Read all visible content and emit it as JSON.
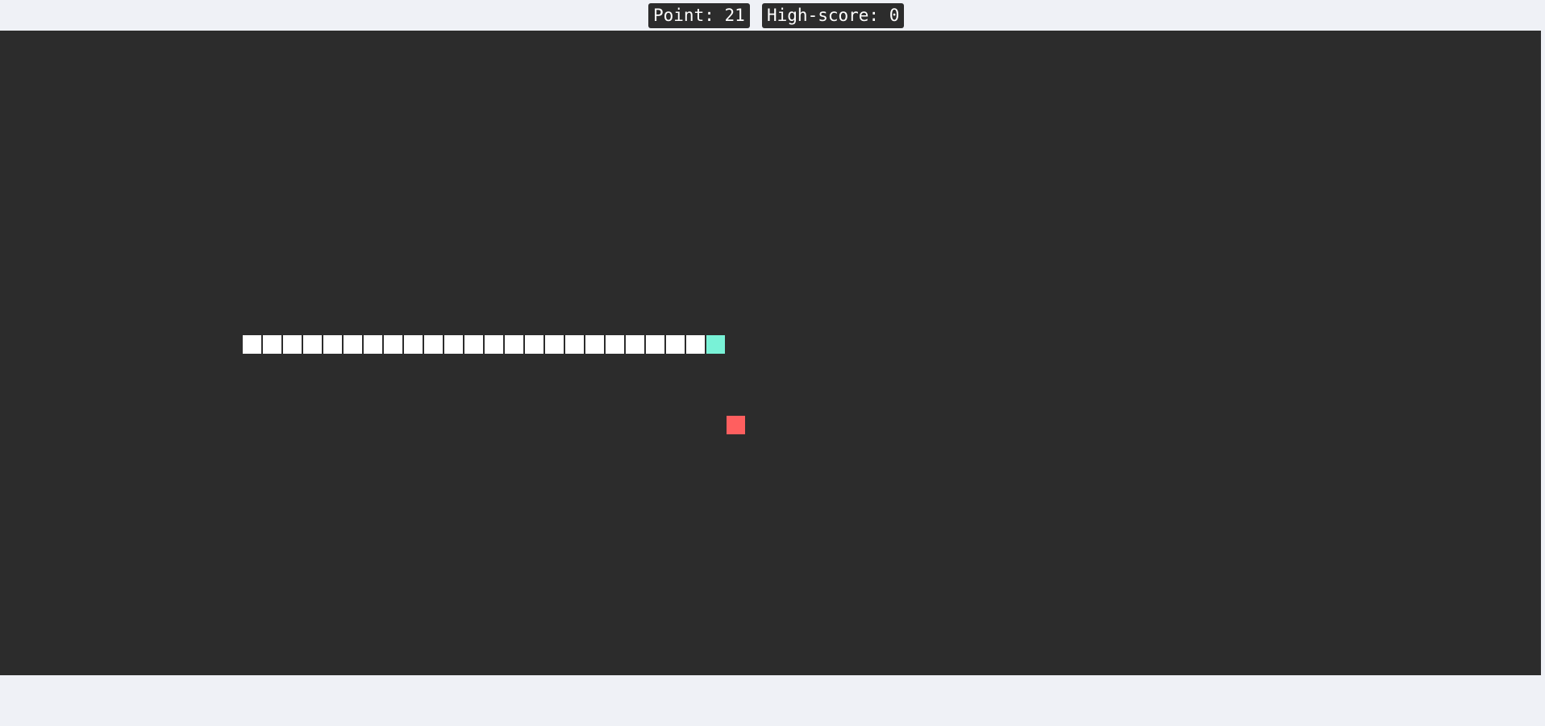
{
  "scoreboard": {
    "point_label": "Point: 21",
    "highscore_label": "High-score: 0"
  },
  "game": {
    "grid_columns": 63,
    "grid_rows": 32,
    "snake": {
      "direction": "right",
      "length": 24,
      "head": {
        "col": 35,
        "row": 15
      },
      "tail": {
        "col": 12,
        "row": 15
      }
    },
    "food": {
      "col": 36,
      "row": 19
    }
  },
  "colors": {
    "page_background": "#eff1f6",
    "board_background": "#2c2c2c",
    "badge_background": "#2c2c2c",
    "badge_text": "#ffffff",
    "snake_body": "#ffffff",
    "snake_head": "#79f2d7",
    "food": "#ff5f5f"
  }
}
